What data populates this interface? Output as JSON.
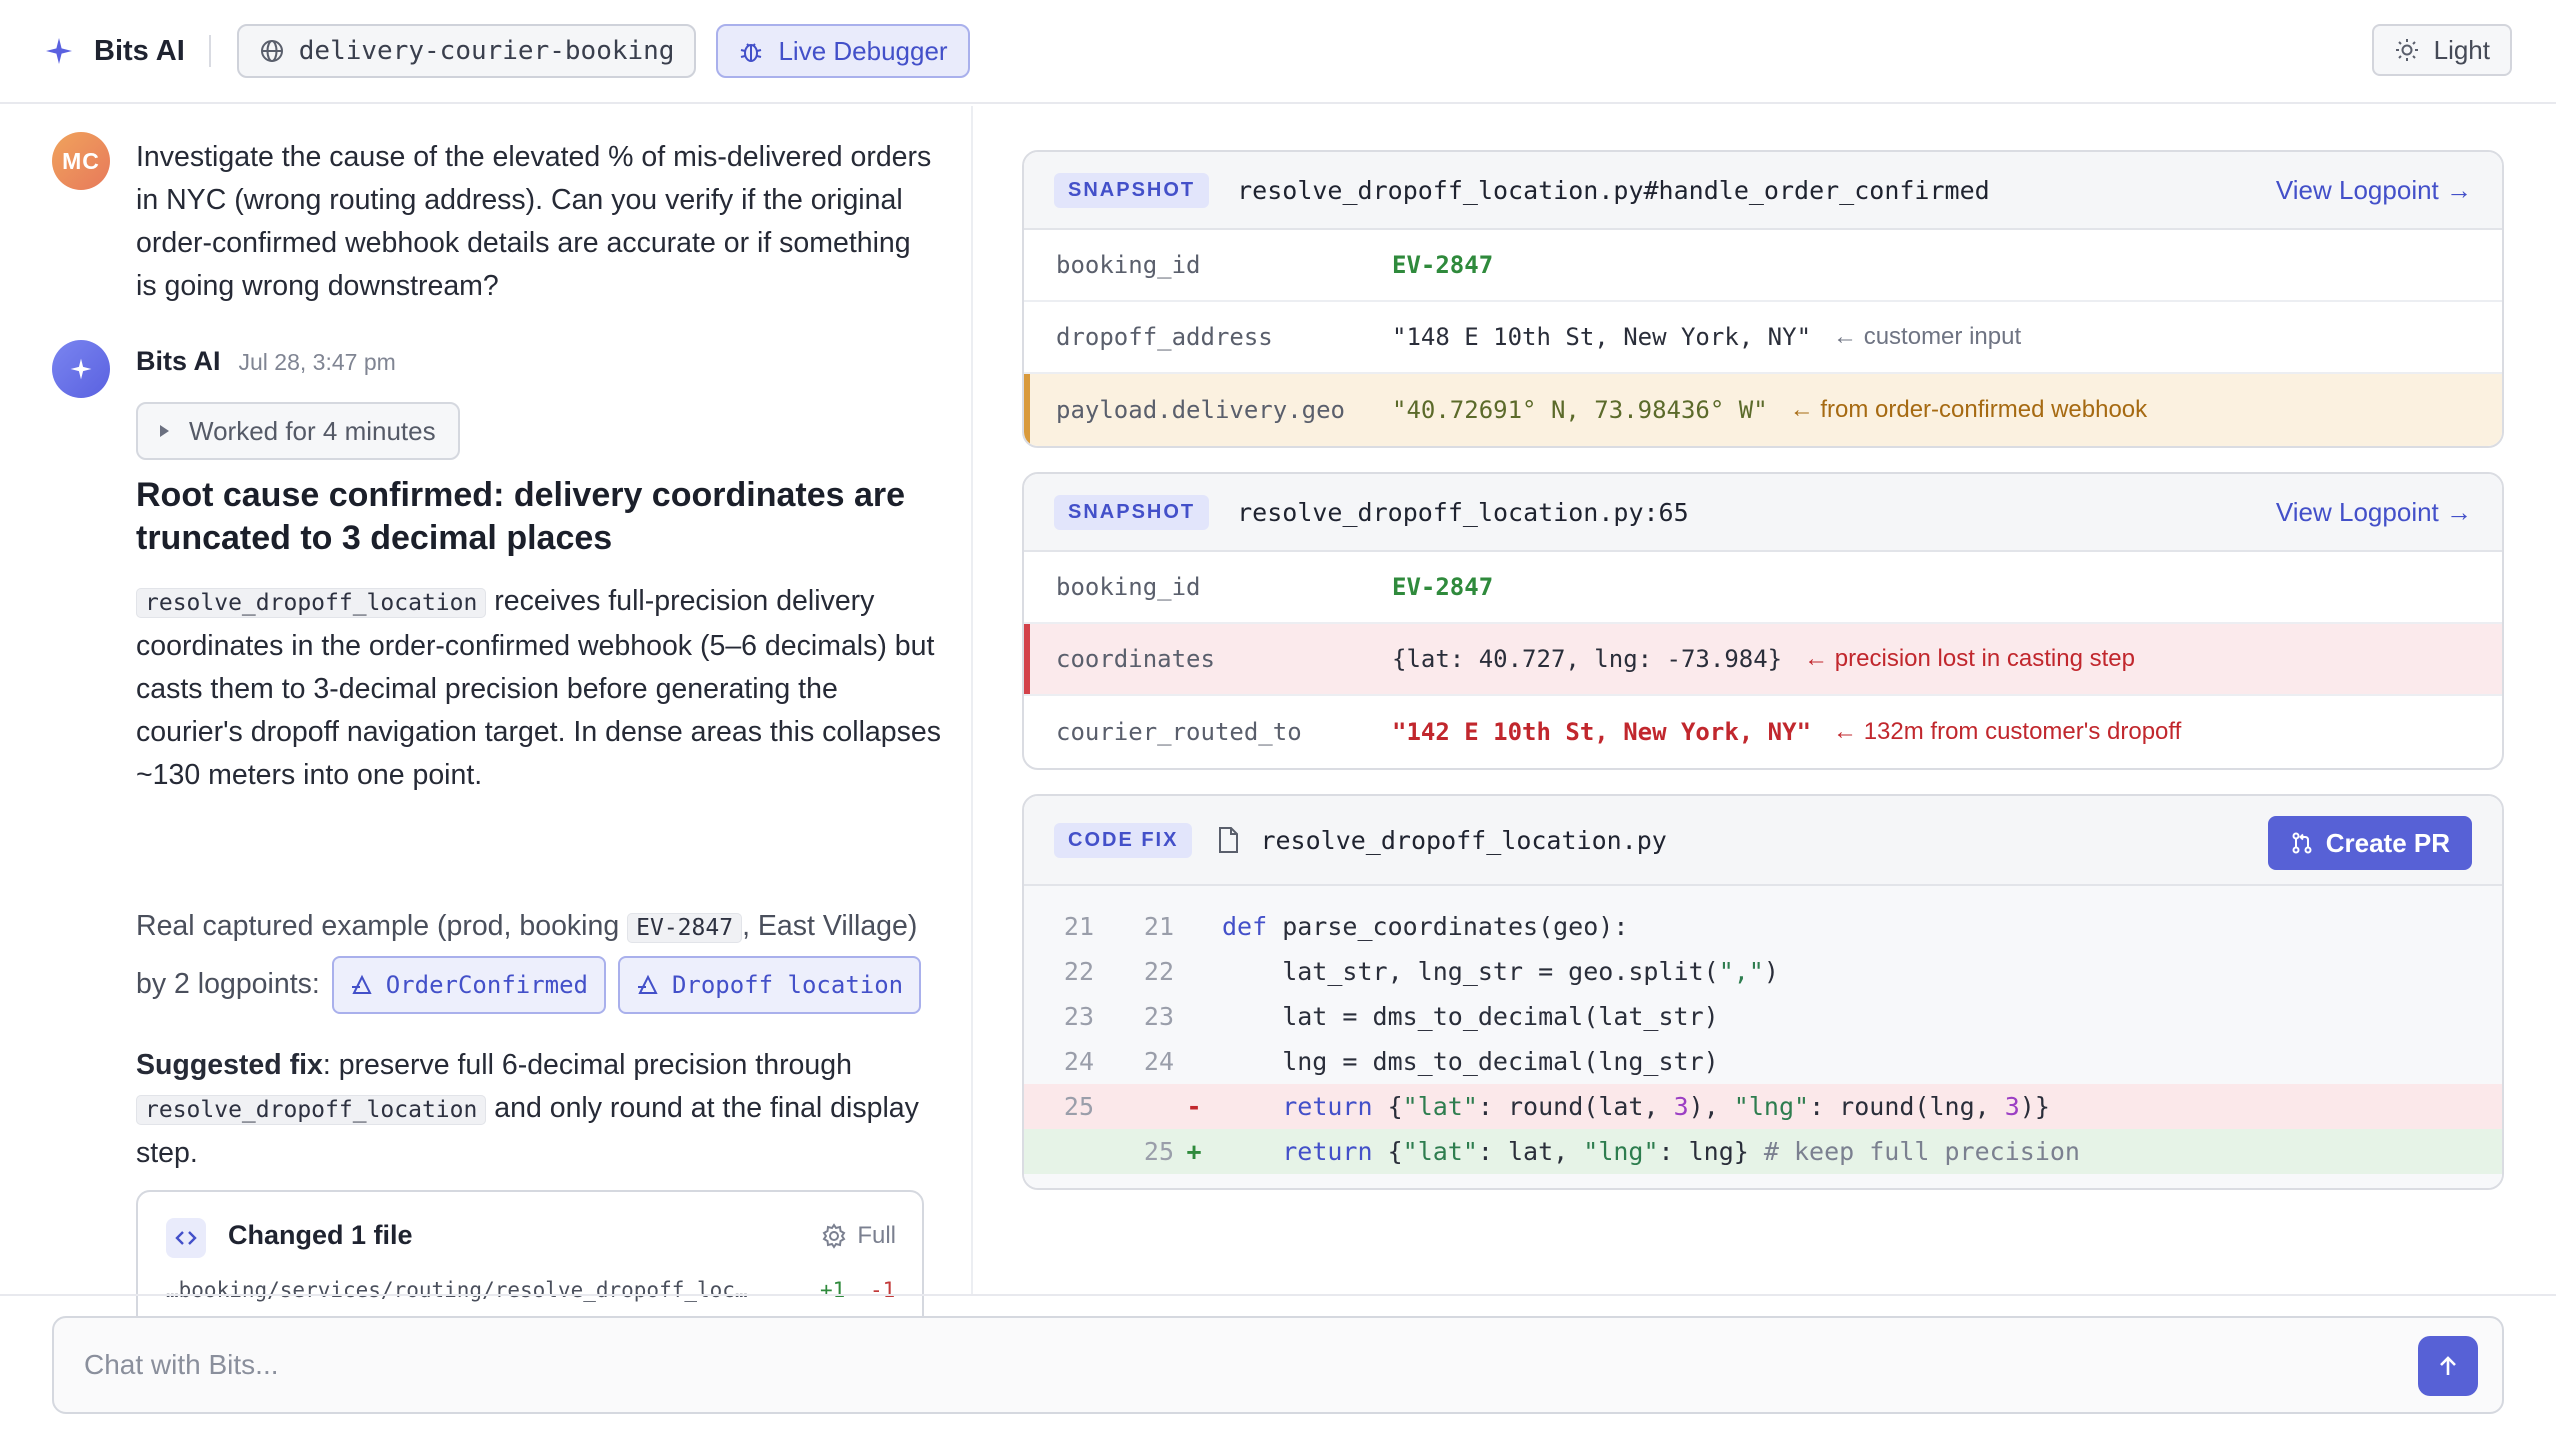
{
  "header": {
    "brand": "Bits AI",
    "service": "delivery-courier-booking",
    "live_debugger": "Live Debugger",
    "theme": "Light"
  },
  "conversation": {
    "user_initials": "MC",
    "user_message": "Investigate the cause of the elevated % of mis-delivered orders in NYC (wrong routing address). Can you verify if the original order-confirmed webhook details are accurate or if something is going wrong downstream?",
    "bot_name": "Bits AI",
    "bot_time": "Jul 28, 3:47 pm",
    "worked_label": "Worked for 4 minutes",
    "root_cause_title": "Root cause confirmed: delivery coordinates are truncated to 3 decimal places",
    "para1_code": "resolve_dropoff_location",
    "para1_text": " receives full-precision delivery coordinates in the order-confirmed webhook (5–6 decimals) but casts them to 3-decimal precision before generating the courier's dropoff navigation target. In dense areas this collapses ~130 meters into one point.",
    "para2_pre": "Real captured example (prod, booking ",
    "para2_code": "EV-2847",
    "para2_post": ", East Village) by 2 logpoints:",
    "logpoint1": "OrderConfirmed",
    "logpoint2": "Dropoff location",
    "fix_label": "Suggested fix",
    "fix_text1": ": preserve full 6-decimal precision through ",
    "fix_code": "resolve_dropoff_location",
    "fix_text2": " and only round at the final display step.",
    "changed_title": "Changed 1 file",
    "changed_full": "Full",
    "changed_path": "…booking/services/routing/resolve_dropoff_loc…",
    "changed_add": "+1",
    "changed_del": "-1"
  },
  "snapshot1": {
    "tag": "SNAPSHOT",
    "file": "resolve_dropoff_location.py#handle_order_confirmed",
    "link": "View Logpoint →",
    "rows": [
      {
        "key": "booking_id",
        "value": "EV-2847",
        "note": ""
      },
      {
        "key": "dropoff_address",
        "value": "\"148 E 10th St, New York, NY\"",
        "note": "← customer input"
      },
      {
        "key": "payload.delivery.geo",
        "value": "\"40.72691° N, 73.98436° W\"",
        "note": "← from order-confirmed webhook"
      }
    ]
  },
  "snapshot2": {
    "tag": "SNAPSHOT",
    "file": "resolve_dropoff_location.py:65",
    "link": "View Logpoint →",
    "rows": [
      {
        "key": "booking_id",
        "value": "EV-2847",
        "note": ""
      },
      {
        "key": "coordinates",
        "value": "{lat: 40.727, lng: -73.984}",
        "note": "← precision lost in casting step"
      },
      {
        "key": "courier_routed_to",
        "value": "\"142 E 10th St, New York, NY\"",
        "note": "← 132m from customer's dropoff"
      }
    ]
  },
  "codefix": {
    "tag": "CODE FIX",
    "file": "resolve_dropoff_location.py",
    "button": "Create PR",
    "lines": [
      {
        "old": "21",
        "new": "21",
        "sign": ""
      },
      {
        "old": "22",
        "new": "22",
        "sign": ""
      },
      {
        "old": "23",
        "new": "23",
        "sign": ""
      },
      {
        "old": "24",
        "new": "24",
        "sign": ""
      },
      {
        "old": "25",
        "new": "",
        "sign": "-"
      },
      {
        "old": "",
        "new": "25",
        "sign": "+"
      }
    ]
  },
  "chat": {
    "placeholder": "Chat with Bits..."
  },
  "colors": {
    "accent": "#5761d6",
    "success": "#2f8a3c",
    "danger": "#c1272d",
    "warning": "#d99a3c"
  }
}
